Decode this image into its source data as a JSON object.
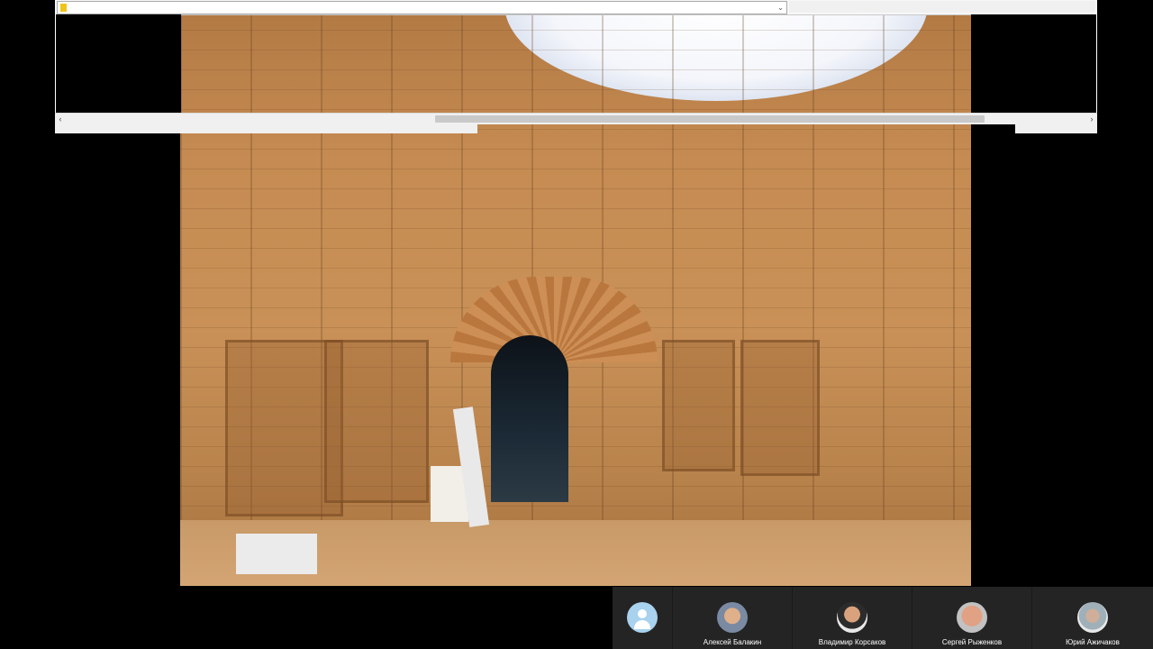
{
  "viewer": {
    "address_value": "",
    "scroll_left_glyph": "‹",
    "scroll_right_glyph": "›",
    "dropdown_glyph": "⌄"
  },
  "participants": [
    {
      "name": "",
      "avatar": "default-user-icon"
    },
    {
      "name": "Алексей Балакин",
      "avatar": "photo"
    },
    {
      "name": "Владимир Корсаков",
      "avatar": "photo"
    },
    {
      "name": "Сергей Рыженков",
      "avatar": "photo"
    },
    {
      "name": "Юрий  Ажичаков",
      "avatar": "photo"
    }
  ],
  "colors": {
    "background": "#000000",
    "participant_bar": "#242424",
    "default_avatar": "#a8d2ee"
  }
}
